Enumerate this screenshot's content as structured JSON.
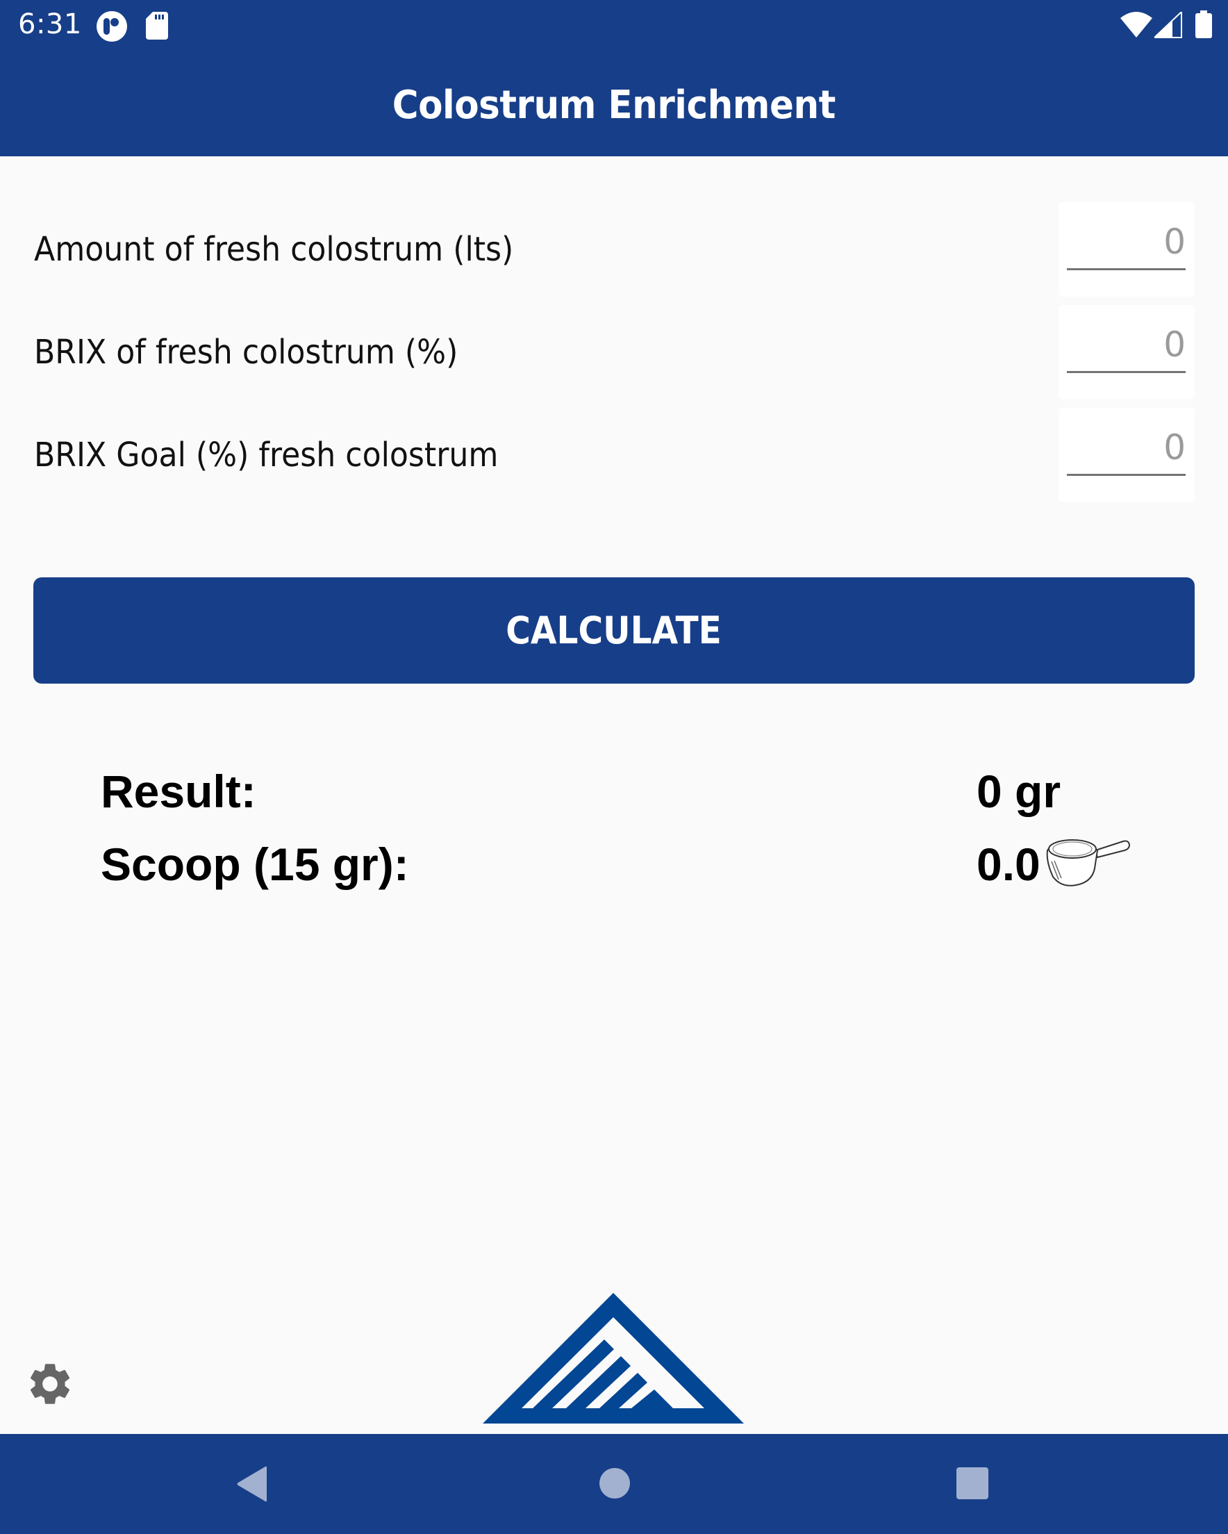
{
  "status_bar": {
    "time": "6:31",
    "left_icons": [
      "app-notification-icon",
      "sd-card-icon"
    ],
    "right_icons": [
      "wifi-icon",
      "cell-signal-icon",
      "battery-icon"
    ]
  },
  "app_bar": {
    "title": "Colostrum Enrichment"
  },
  "form": {
    "fields": [
      {
        "label": "Amount of fresh colostrum (lts)",
        "value": "",
        "placeholder": "0"
      },
      {
        "label": "BRIX of fresh colostrum (%)",
        "value": "",
        "placeholder": "0"
      },
      {
        "label": "BRIX Goal (%) fresh colostrum",
        "value": "",
        "placeholder": "0"
      }
    ],
    "calculate_label": "CALCULATE"
  },
  "results": {
    "result_label": "Result:",
    "result_value": "0 gr",
    "scoop_label": "Scoop (15 gr):",
    "scoop_value": "0.0",
    "scoop_icon": "measuring-scoop-icon"
  },
  "footer": {
    "settings_icon": "gear-icon",
    "logo": "mountain-logo"
  },
  "nav_bar": {
    "buttons": [
      "back",
      "home",
      "recents"
    ]
  },
  "colors": {
    "primary": "#173e88",
    "logo_blue": "#034694",
    "background": "#fafafa",
    "hint_text": "#9a9a9a",
    "icon_grey": "#666666"
  }
}
